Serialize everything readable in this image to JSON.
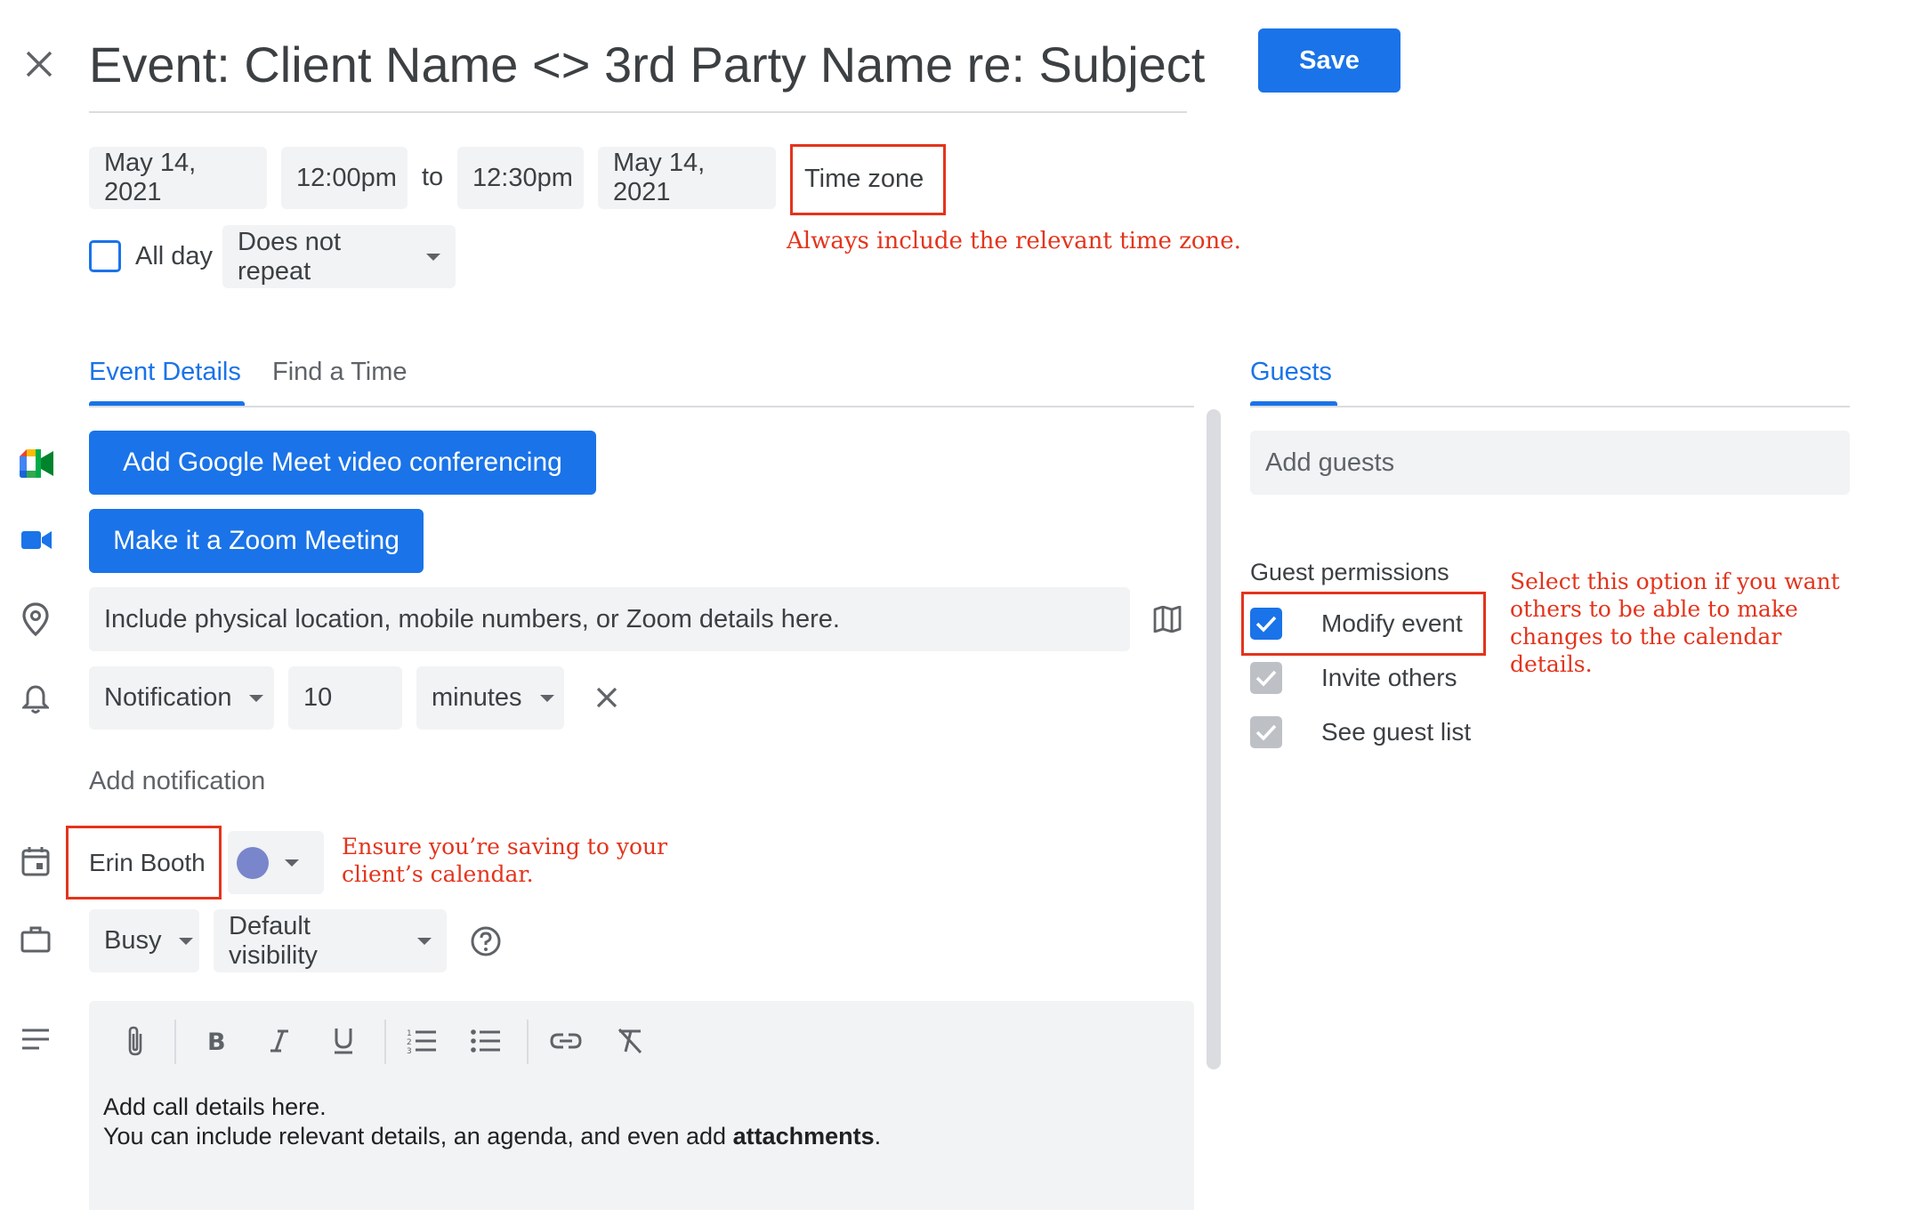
{
  "header": {
    "close_icon": "close-icon",
    "title": "Event: Client Name <> 3rd Party Name re: Subject",
    "save_label": "Save"
  },
  "datetime": {
    "start_date": "May 14, 2021",
    "start_time": "12:00pm",
    "to_label": "to",
    "end_time": "12:30pm",
    "end_date": "May 14, 2021",
    "time_zone_label": "Time zone",
    "all_day_label": "All day",
    "all_day_checked": false,
    "repeat_value": "Does not repeat"
  },
  "annotations": {
    "time_zone": "Always include the relevant time zone.",
    "guests_permission": [
      "Select this option if you want",
      "others to be able to make",
      "changes to the calendar",
      "details."
    ],
    "calendar": [
      "Ensure you’re saving to your",
      "client’s calendar."
    ]
  },
  "tabs": {
    "event_details": "Event Details",
    "find_a_time": "Find a Time",
    "guests": "Guests"
  },
  "details": {
    "meet_button": "Add Google Meet video conferencing",
    "zoom_button": "Make it a Zoom Meeting",
    "location_value": "Include physical location, mobile numbers, or Zoom details here.",
    "notification_type": "Notification",
    "notification_amount": "10",
    "notification_unit": "minutes",
    "add_notification": "Add notification",
    "calendar_owner": "Erin Booth",
    "calendar_color": "#7986cb",
    "availability": "Busy",
    "visibility": "Default visibility",
    "description_line1": "Add call details here.",
    "description_line2_prefix": "You can include relevant details, an agenda, and even add ",
    "description_line2_bold": "attachments",
    "description_line2_suffix": "."
  },
  "guests": {
    "add_placeholder": "Add guests",
    "permissions_title": "Guest permissions",
    "permissions": [
      {
        "label": "Modify event",
        "checked": true,
        "enabled": true
      },
      {
        "label": "Invite others",
        "checked": true,
        "enabled": false
      },
      {
        "label": "See guest list",
        "checked": true,
        "enabled": false
      }
    ]
  },
  "colors": {
    "accent": "#1a73e8",
    "annotation_red": "#e3341c",
    "field_bg": "#f1f3f4"
  }
}
